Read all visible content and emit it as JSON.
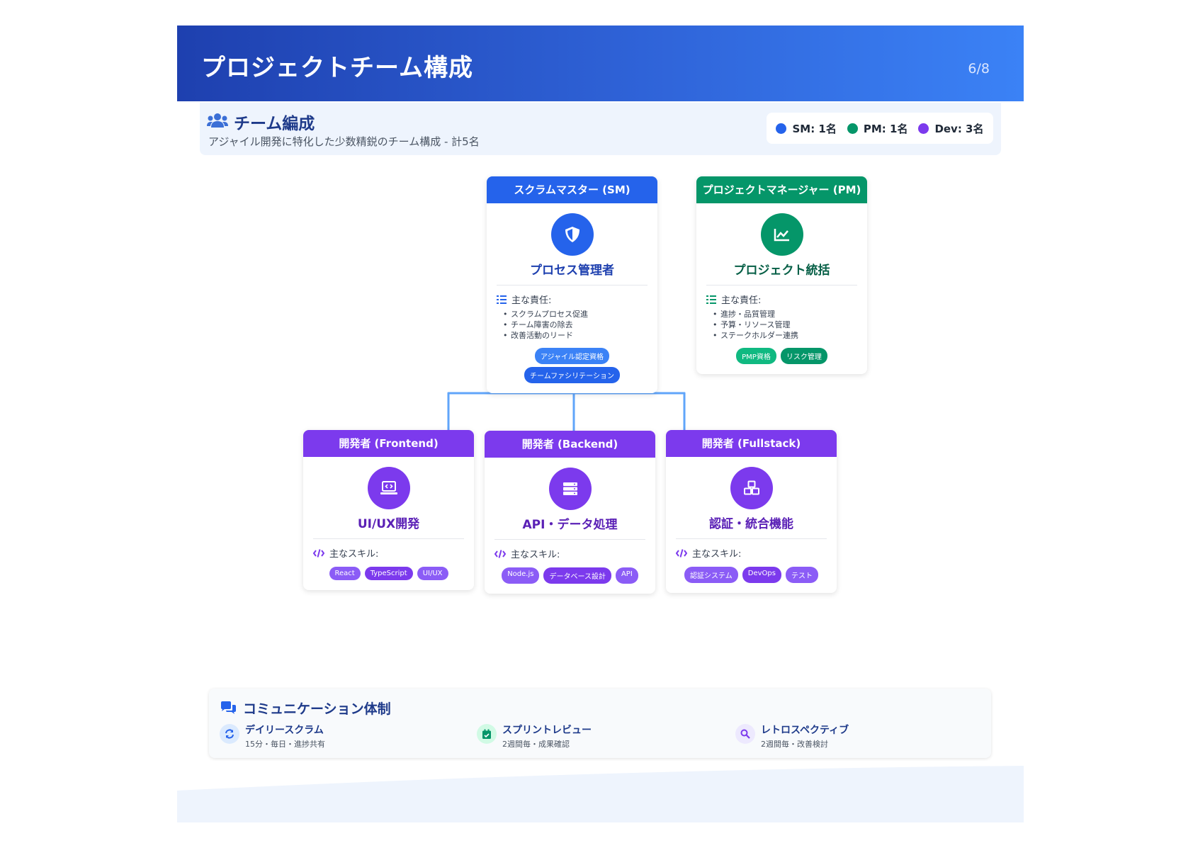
{
  "header": {
    "title": "プロジェクトチーム構成",
    "page": "6/8"
  },
  "team": {
    "title": "チーム編成",
    "subtitle": "アジャイル開発に特化した少数精鋭のチーム構成 - 計5名",
    "legend": [
      {
        "label": "SM: 1名",
        "color": "#2563eb"
      },
      {
        "label": "PM: 1名",
        "color": "#059669"
      },
      {
        "label": "Dev: 3名",
        "color": "#7c3aed"
      }
    ]
  },
  "colors": {
    "sm": "#2563eb",
    "pm": "#059669",
    "dev": "#7c3aed",
    "connector": "#60a5fa"
  },
  "roles": {
    "sm": {
      "header": "スクラムマスター (SM)",
      "icon": "shield-icon",
      "title": "プロセス管理者",
      "label": "主な責任:",
      "items": [
        "スクラムプロセス促進",
        "チーム障害の除去",
        "改善活動のリード"
      ],
      "tags": [
        "アジャイル認定資格",
        "チームファシリテーション"
      ]
    },
    "pm": {
      "header": "プロジェクトマネージャー (PM)",
      "icon": "chart-line-icon",
      "title": "プロジェクト統括",
      "label": "主な責任:",
      "items": [
        "進捗・品質管理",
        "予算・リソース管理",
        "ステークホルダー連携"
      ],
      "tags": [
        "PMP資格",
        "リスク管理"
      ]
    },
    "frontend": {
      "header": "開発者 (Frontend)",
      "icon": "laptop-code-icon",
      "title": "UI/UX開発",
      "label": "主なスキル:",
      "tags": [
        "React",
        "TypeScript",
        "UI/UX"
      ]
    },
    "backend": {
      "header": "開発者 (Backend)",
      "icon": "server-icon",
      "title": "API・データ処理",
      "label": "主なスキル:",
      "tags": [
        "Node.js",
        "データベース設計",
        "API"
      ]
    },
    "fullstack": {
      "header": "開発者 (Fullstack)",
      "icon": "cubes-icon",
      "title": "認証・統合機能",
      "label": "主なスキル:",
      "tags": [
        "認証システム",
        "DevOps",
        "テスト"
      ]
    }
  },
  "communication": {
    "title": "コミュニケーション体制",
    "items": [
      {
        "name": "デイリースクラム",
        "desc": "15分・毎日・進捗共有",
        "icon": "sync-icon"
      },
      {
        "name": "スプリントレビュー",
        "desc": "2週間毎・成果確認",
        "icon": "calendar-check-icon"
      },
      {
        "name": "レトロスペクティブ",
        "desc": "2週間毎・改善検討",
        "icon": "search-icon"
      }
    ]
  }
}
